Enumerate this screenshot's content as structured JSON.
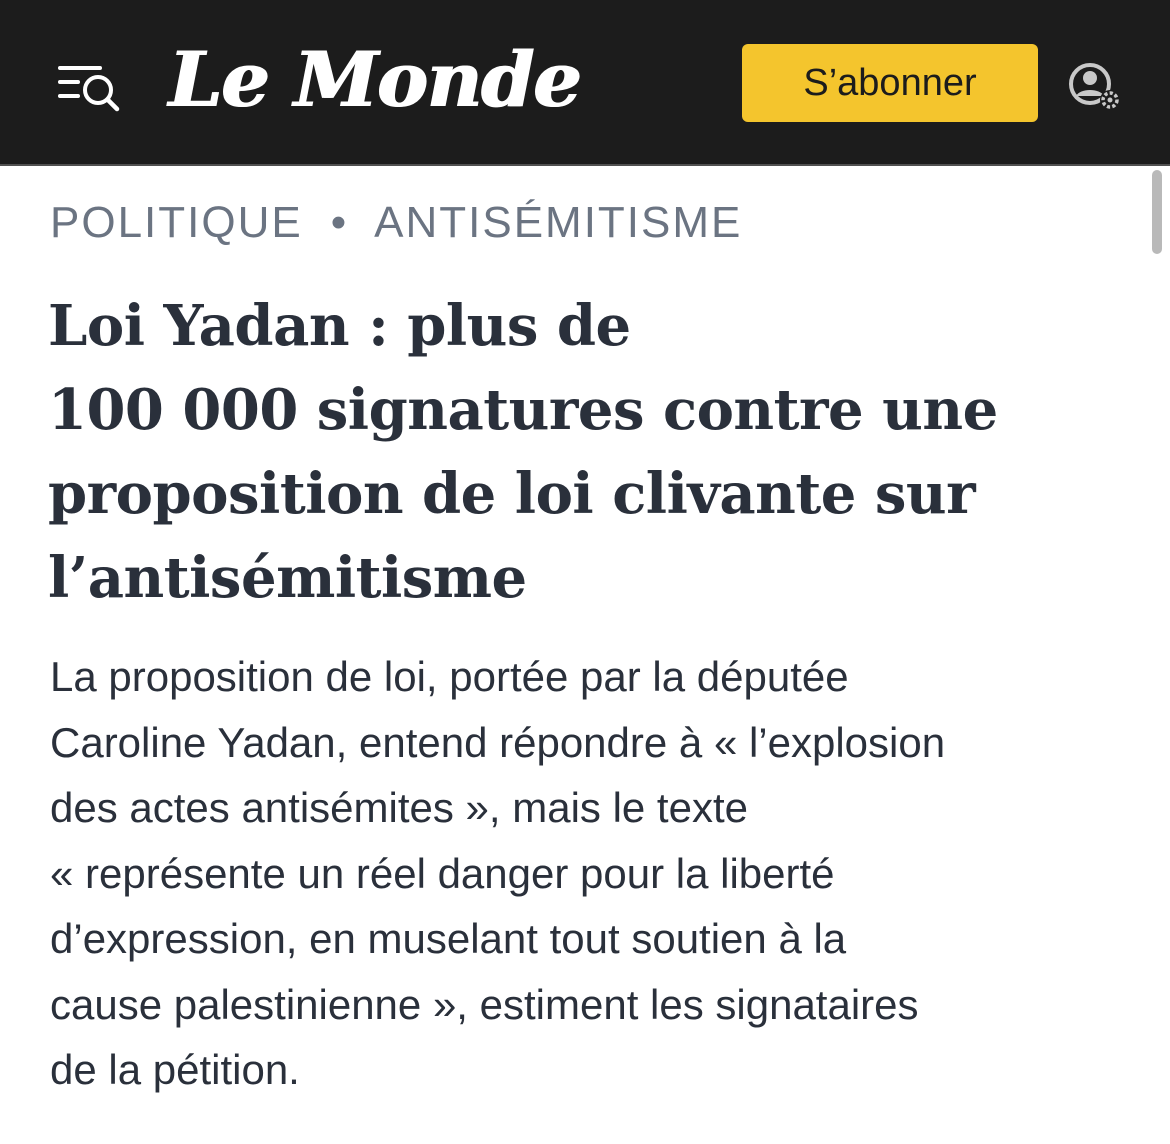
{
  "header": {
    "logo_text": "Le Monde",
    "subscribe_label": "S’abonner",
    "menu_icon": "menu-search-icon",
    "account_icon": "account-settings-icon"
  },
  "article": {
    "kicker": {
      "section": "POLITIQUE",
      "separator": "•",
      "topic": "ANTISÉMITISME"
    },
    "headline_lines": [
      "Loi Yadan : plus de",
      "100 000 signatures contre une",
      "proposition de loi clivante sur",
      "l’antisémitisme"
    ],
    "standfirst_lines": [
      "La proposition de loi, portée par la députée",
      "Caroline Yadan, entend répondre à « l’explosion",
      "des actes antisémites », mais le texte",
      "« représente un réel danger pour la liberté",
      "d’expression, en muselant tout soutien à la",
      "cause palestinienne », estiment les signataires",
      "de la pétition."
    ]
  },
  "colors": {
    "header_bg": "#1c1c1c",
    "subscribe_bg": "#f4c52d",
    "kicker": "#6b7482",
    "text": "#2a303b"
  }
}
